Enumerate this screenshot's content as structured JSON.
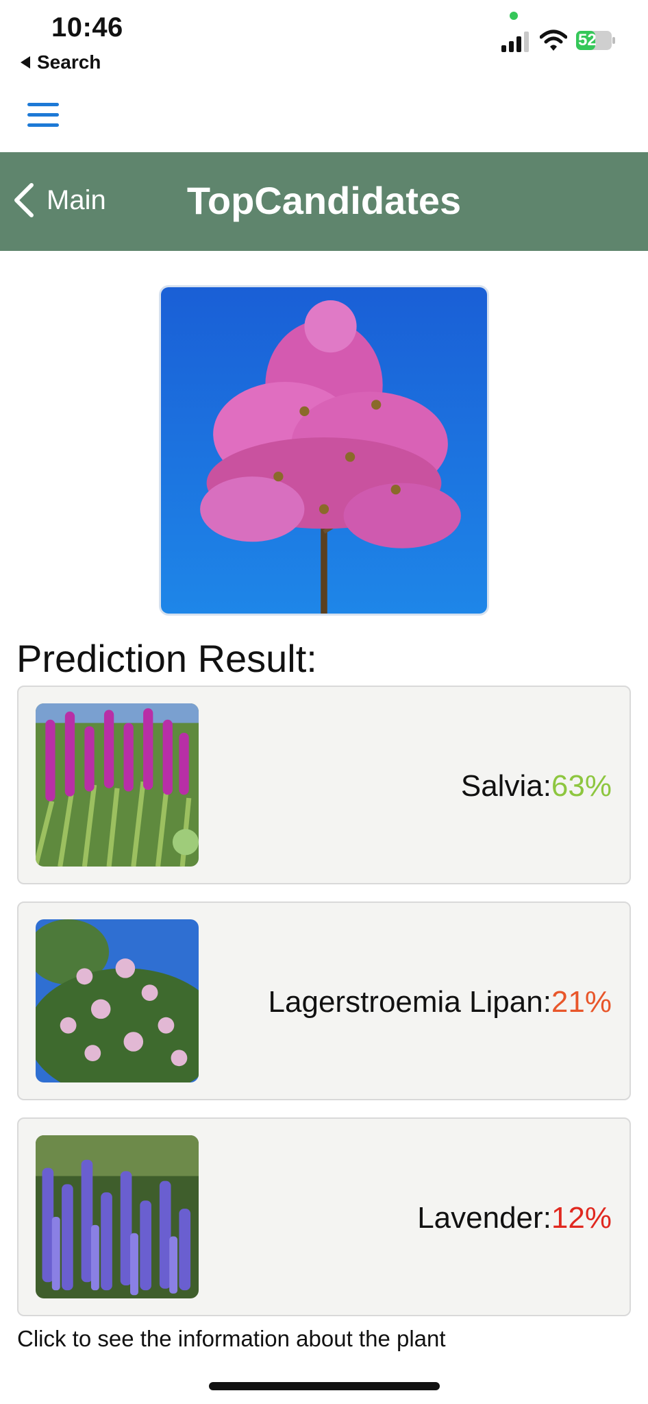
{
  "status_bar": {
    "time": "10:46",
    "back_label": "Search",
    "battery": "52",
    "icons": [
      "signal-icon",
      "wifi-icon",
      "battery-charging-icon"
    ]
  },
  "menu": {
    "icon": "hamburger-icon"
  },
  "nav": {
    "back_label": "Main",
    "title": "TopCandidates"
  },
  "main_image": {
    "icon": "crape-myrtle-photo"
  },
  "results": {
    "heading": "Prediction Result:",
    "items": [
      {
        "name": "Salvia",
        "separator": ":",
        "percent": "63%",
        "color": "#8dc63f",
        "thumb": "salvia-photo"
      },
      {
        "name": "Lagerstroemia Lipan",
        "separator": ":",
        "percent": "21%",
        "color": "#e8562a",
        "thumb": "lagerstroemia-photo"
      },
      {
        "name": "Lavender",
        "separator": ":",
        "percent": "12%",
        "color": "#e0281f",
        "thumb": "lavender-photo"
      }
    ]
  },
  "footer": {
    "note": "Click to see the information about the plant"
  },
  "colors": {
    "nav_bg": "#5f856d",
    "accent_blue": "#1d79d6",
    "card_bg": "#f4f4f2"
  }
}
